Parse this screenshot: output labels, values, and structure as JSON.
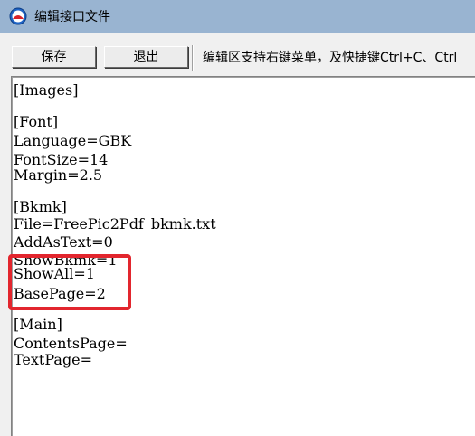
{
  "window": {
    "title": "编辑接口文件",
    "icon": "app-logo-icon"
  },
  "toolbar": {
    "save_label": "保存",
    "exit_label": "退出",
    "hint": "编辑区支持右键菜单，及快捷键Ctrl+C、Ctrl"
  },
  "editor": {
    "lines": [
      "[Images]",
      "",
      "[Font]",
      "Language=GBK",
      "FontSize=14",
      "Margin=2.5",
      "",
      "[Bkmk]",
      "File=FreePic2Pdf_bkmk.txt",
      "AddAsText=0",
      "ShowBkmk=1",
      "ShowAll=1",
      "BasePage=2",
      "",
      "[Main]",
      "ContentsPage=",
      "TextPage="
    ]
  },
  "annotation": {
    "color": "#e2262e",
    "highlighted_lines": [
      "ShowAll=1",
      "BasePage=2"
    ]
  },
  "colors": {
    "titlebar": "#99b4d1",
    "window_bg": "#f0f0f0",
    "editor_bg": "#ffffff"
  }
}
